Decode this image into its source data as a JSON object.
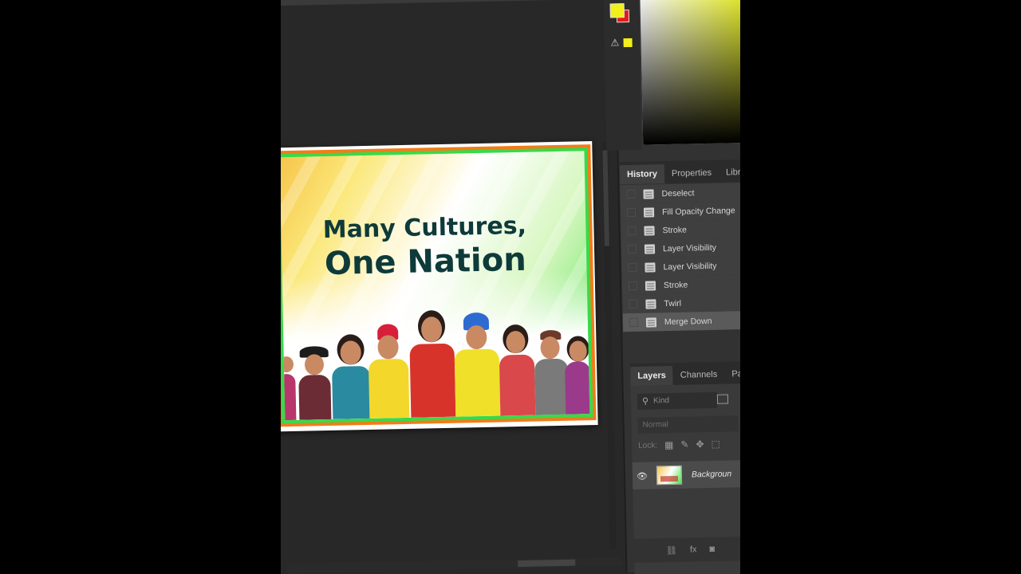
{
  "document": {
    "headline_line1": "Many Cultures,",
    "headline_line2": "One Nation"
  },
  "colors": {
    "foreground": "#f3ef1a",
    "background": "#e11c1c",
    "border_orange": "#f07d1a",
    "border_green": "#39d94a",
    "headline": "#0e3a3a"
  },
  "history_panel": {
    "tabs": [
      {
        "label": "History",
        "active": true
      },
      {
        "label": "Properties",
        "active": false
      },
      {
        "label": "Libra",
        "active": false
      }
    ],
    "items": [
      {
        "label": "Deselect",
        "selected": false
      },
      {
        "label": "Fill Opacity Change",
        "selected": false
      },
      {
        "label": "Stroke",
        "selected": false
      },
      {
        "label": "Layer Visibility",
        "selected": false
      },
      {
        "label": "Layer Visibility",
        "selected": false
      },
      {
        "label": "Stroke",
        "selected": false
      },
      {
        "label": "Twirl",
        "selected": false
      },
      {
        "label": "Merge Down",
        "selected": true
      }
    ]
  },
  "layers_panel": {
    "tabs": [
      {
        "label": "Layers",
        "active": true
      },
      {
        "label": "Channels",
        "active": false
      },
      {
        "label": "Path",
        "active": false
      }
    ],
    "kind_placeholder": "Kind",
    "blend_mode": "Normal",
    "lock_label": "Lock:",
    "layer_name": "Backgroun",
    "footer_icons": [
      "link-icon",
      "fx-icon",
      "mask-icon"
    ]
  },
  "icons": {
    "gamut_warning": "warning-icon",
    "visibility": "eye-icon"
  }
}
